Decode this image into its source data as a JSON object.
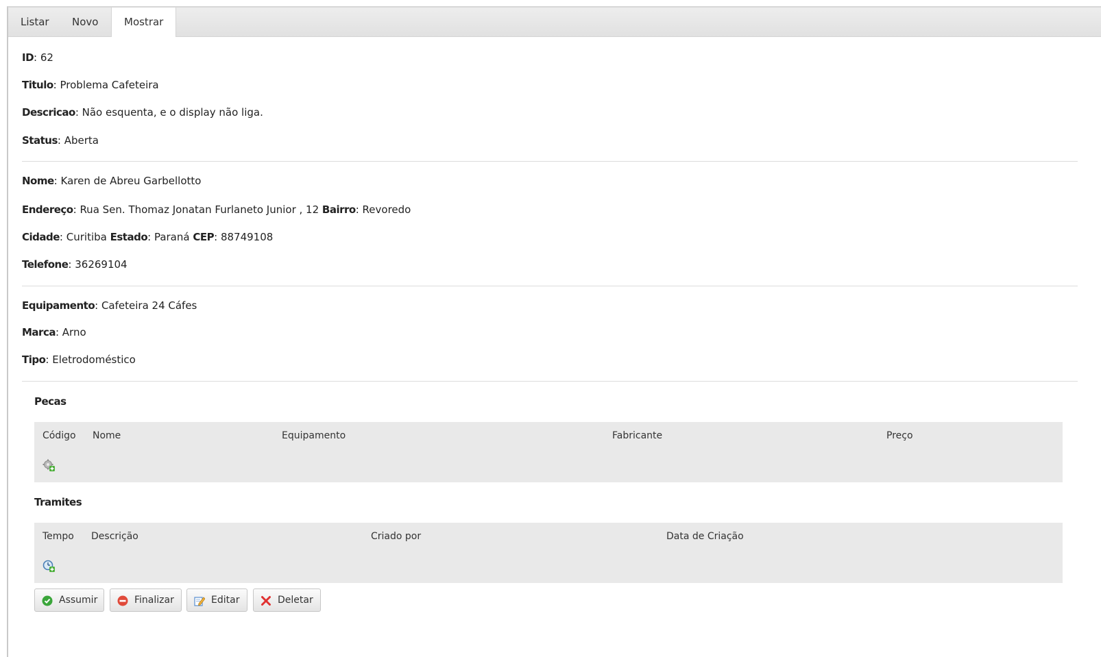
{
  "tabs": [
    {
      "label": "Listar"
    },
    {
      "label": "Novo"
    },
    {
      "label": "Mostrar"
    }
  ],
  "ticket": {
    "id_label": "ID",
    "id_value": "62",
    "titulo_label": "Titulo",
    "titulo_value": "Problema Cafeteira",
    "descricao_label": "Descricao",
    "descricao_value": "Não esquenta, e o display não liga.",
    "status_label": "Status",
    "status_value": "Aberta"
  },
  "client": {
    "nome_label": "Nome",
    "nome_value": "Karen de Abreu Garbellotto",
    "endereco_label": "Endereço",
    "endereco_value": "Rua Sen. Thomaz Jonatan Furlaneto Junior , 12",
    "bairro_label": "Bairro",
    "bairro_value": "Revoredo",
    "cidade_label": "Cidade",
    "cidade_value": "Curitiba",
    "estado_label": "Estado",
    "estado_value": "Paraná",
    "cep_label": "CEP",
    "cep_value": "88749108",
    "telefone_label": "Telefone",
    "telefone_value": "36269104"
  },
  "equipment": {
    "equipamento_label": "Equipamento",
    "equipamento_value": "Cafeteira 24 Cáfes",
    "marca_label": "Marca",
    "marca_value": "Arno",
    "tipo_label": "Tipo",
    "tipo_value": "Eletrodoméstico"
  },
  "pecas": {
    "title": "Pecas",
    "columns": [
      "Código",
      "Nome",
      "Equipamento",
      "Fabricante",
      "Preço"
    ],
    "add_icon": "gear-add-icon"
  },
  "tramites": {
    "title": "Tramites",
    "columns": [
      "Tempo",
      "Descrição",
      "Criado por",
      "Data de Criação"
    ],
    "add_icon": "clock-add-icon"
  },
  "actions": {
    "assumir": {
      "label": "Assumir",
      "icon": "check-circle-icon",
      "color": "#3aa53a"
    },
    "finalizar": {
      "label": "Finalizar",
      "icon": "minus-circle-icon",
      "color": "#e04a3a"
    },
    "editar": {
      "label": "Editar",
      "icon": "edit-icon",
      "color": "#5a8fd0"
    },
    "deletar": {
      "label": "Deletar",
      "icon": "x-icon",
      "color": "#e03030"
    }
  }
}
